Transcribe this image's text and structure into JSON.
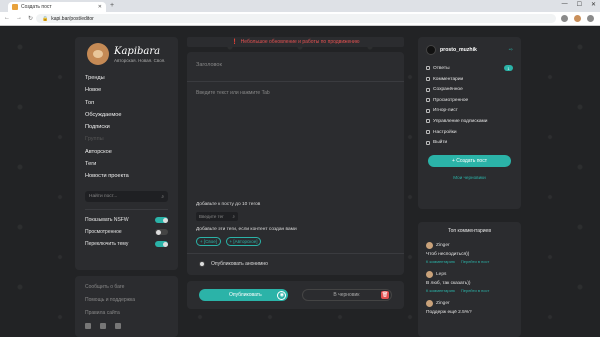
{
  "browser": {
    "tab_title": "Создать пост",
    "url": "kapi.bar/post/editor"
  },
  "left": {
    "brand": "Kapibara",
    "tagline": "Авторская. Новая. Своя.",
    "menu": [
      "Тренды",
      "Новое",
      "Топ",
      "Обсуждаемое",
      "Подписки",
      "Группы",
      "Авторское",
      "Теги",
      "Новости проекта"
    ],
    "search_placeholder": "Найти пост...",
    "toggles": [
      {
        "label": "Показывать NSFW",
        "state": "on"
      },
      {
        "label": "Просмотренное",
        "state": "off"
      },
      {
        "label": "Переключить тему",
        "state": "on"
      }
    ],
    "links": [
      "Сообщить о баге",
      "Помощь и поддержка",
      "Правила сайта"
    ]
  },
  "center": {
    "alert": "Небольшое обновление и работы по продвижению",
    "title_placeholder": "Заголовок",
    "body_placeholder": "Введите текст или нажмите Tab",
    "tags_label": "Добавьте к посту до 10 тегов",
    "tag_input_placeholder": "Введите тег",
    "tags_hint": "Добавьте эти теги, если контент создан вами",
    "chips": [
      "+ [Свое]",
      "+ [Авторское]"
    ],
    "anon_label": "Опубликовать анонимно",
    "publish_label": "Опубликовать",
    "draft_label": "В черновик"
  },
  "right": {
    "username": "prosto_muzhik",
    "menu": [
      {
        "label": "Ответы",
        "badge": "1"
      },
      {
        "label": "Комментарии"
      },
      {
        "label": "Сохранённое"
      },
      {
        "label": "Просмотренное"
      },
      {
        "label": "Игнор-лист"
      },
      {
        "label": "Управление подписками"
      },
      {
        "label": "Настройки"
      },
      {
        "label": "Выйти"
      }
    ],
    "create_label": "+ Создать пост",
    "drafts_label": "Мои черновики",
    "top_title": "Топ комментариев",
    "comments": [
      {
        "author": "Zinger",
        "text": "Чтоб несподиться))",
        "link1": "К комментарию",
        "link2": "Перейти в пост"
      },
      {
        "author": "Leps",
        "text": "В люб, так сказать))",
        "link1": "К комментарию",
        "link2": "Перейти в пост"
      },
      {
        "author": "Zinger",
        "text": "Поддерж ещё 2.5%?",
        "link1": "",
        "link2": ""
      }
    ]
  }
}
